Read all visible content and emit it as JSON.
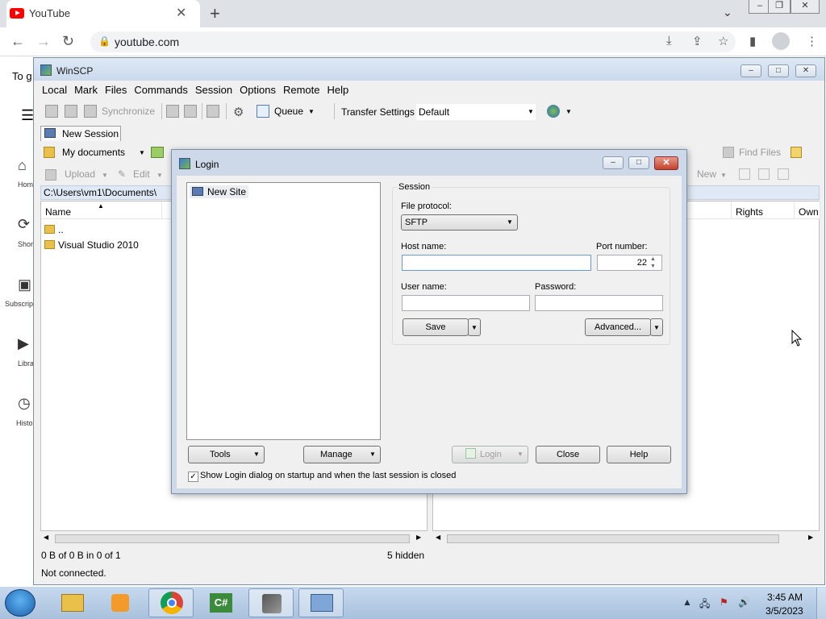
{
  "browser": {
    "tab_title": "YouTube",
    "url": "youtube.com",
    "tab_close": "✕",
    "new_tab": "+",
    "tab_chevron": "⌄"
  },
  "youtube": {
    "partial_text": "To g",
    "nav": [
      "Hom",
      "Shor",
      "Subscrip",
      "Libra",
      "Histo"
    ]
  },
  "winscp": {
    "title": "WinSCP",
    "menu": [
      "Local",
      "Mark",
      "Files",
      "Commands",
      "Session",
      "Options",
      "Remote",
      "Help"
    ],
    "toolbar": {
      "synchronize": "Synchronize",
      "queue": "Queue",
      "transfer_settings": "Transfer Settings",
      "transfer_default": "Default"
    },
    "session_tab": "New Session",
    "local": {
      "location": "My documents",
      "upload": "Upload",
      "edit": "Edit",
      "path": "C:\\Users\\vm1\\Documents\\",
      "col_name": "Name",
      "files": [
        "..",
        "Visual Studio 2010"
      ]
    },
    "remote": {
      "find_files": "Find Files",
      "new": "New",
      "col_rights": "Rights",
      "col_owner": "Own"
    },
    "status": {
      "selection": "0 B of 0 B in 0 of 1",
      "hidden": "5 hidden",
      "connection": "Not connected."
    }
  },
  "login": {
    "title": "Login",
    "site": "New Site",
    "session_label": "Session",
    "file_protocol_label": "File protocol:",
    "file_protocol": "SFTP",
    "host_label": "Host name:",
    "host_value": "",
    "port_label": "Port number:",
    "port_value": "22",
    "user_label": "User name:",
    "password_label": "Password:",
    "save": "Save",
    "advanced": "Advanced...",
    "tools": "Tools",
    "manage": "Manage",
    "login_btn": "Login",
    "close_btn": "Close",
    "help_btn": "Help",
    "show_login_checkbox": "Show Login dialog on startup and when the last session is closed",
    "show_login_checked": true
  },
  "taskbar": {
    "time": "3:45 AM",
    "date": "3/5/2023"
  }
}
